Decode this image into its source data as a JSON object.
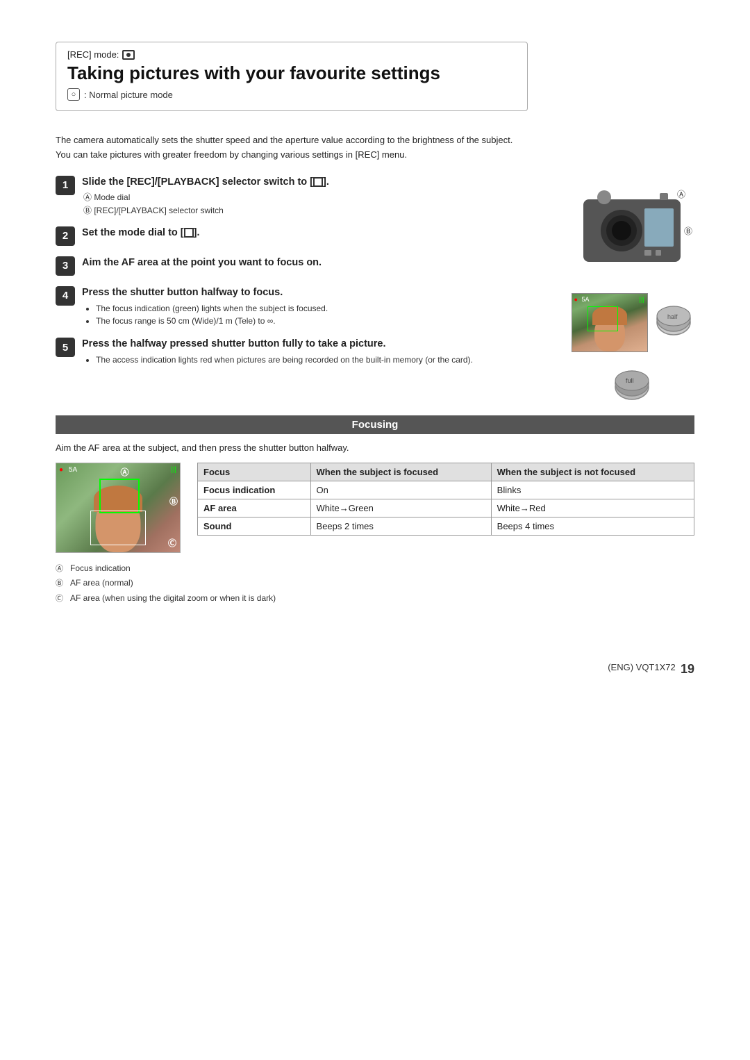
{
  "rec_mode": {
    "label": "[REC] mode:",
    "icon_label": "REC icon"
  },
  "page_title": "Taking pictures with your favourite settings",
  "subtitle": {
    "icon": "□",
    "text": ": Normal picture mode"
  },
  "intro": {
    "line1": "The camera automatically sets the shutter speed and the aperture value according to the brightness of the subject.",
    "line2": "You can take pictures with greater freedom by changing various settings in [REC] menu."
  },
  "steps": [
    {
      "num": "1",
      "heading": "Slide the [REC]/[PLAYBACK] selector switch to [",
      "heading_icon": "■",
      "heading_end": "].",
      "subs": [
        "Ⓐ Mode dial",
        "Ⓑ [REC]/[PLAYBACK] selector switch"
      ]
    },
    {
      "num": "2",
      "heading": "Set the mode dial to [",
      "heading_icon": "□",
      "heading_end": "]."
    },
    {
      "num": "3",
      "heading": "Aim the AF area at the point you want to focus on."
    },
    {
      "num": "4",
      "heading": "Press the shutter button halfway to focus.",
      "bullets": [
        "The focus indication (green) lights when the subject is focused.",
        "The focus range is 50 cm (Wide)/1 m (Tele) to ∞."
      ]
    },
    {
      "num": "5",
      "heading": "Press the halfway pressed shutter button fully to take a picture.",
      "bullets": [
        "The access indication lights red when pictures are being recorded on the built-in memory (or the card)."
      ]
    }
  ],
  "focusing": {
    "title": "Focusing",
    "desc": "Aim the AF area at the subject, and then press the shutter button halfway.",
    "photo_labels": {
      "a": "Ⓐ",
      "b": "Ⓑ",
      "c": "Ⓒ"
    },
    "table": {
      "headers": [
        "Focus",
        "When the subject is focused",
        "When the subject is not focused"
      ],
      "rows": [
        [
          "Focus indication",
          "On",
          "Blinks"
        ],
        [
          "AF area",
          "White→Green",
          "White→Red"
        ],
        [
          "Sound",
          "Beeps 2 times",
          "Beeps 4 times"
        ]
      ]
    },
    "captions": [
      {
        "label": "Ⓐ",
        "text": "Focus indication"
      },
      {
        "label": "Ⓑ",
        "text": "AF area (normal)"
      },
      {
        "label": "Ⓒ",
        "text": "AF area (when using the digital zoom or when it is dark)"
      }
    ]
  },
  "footer": {
    "product": "(ENG) VQT1X72",
    "page_number": "19"
  }
}
